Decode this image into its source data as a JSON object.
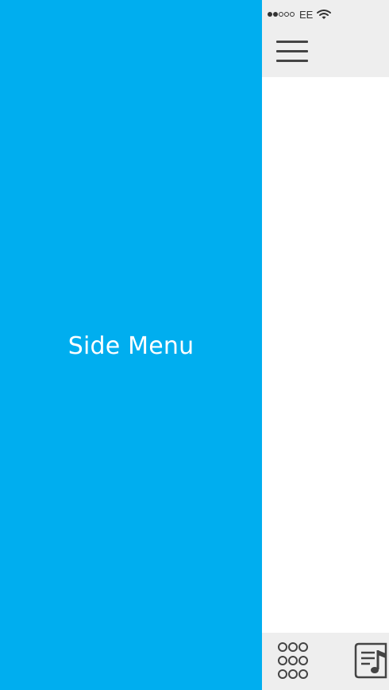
{
  "side_menu": {
    "label": "Side Menu",
    "background_color": "#00AEEF"
  },
  "status_bar": {
    "signal_filled": 2,
    "signal_total": 5,
    "carrier": "EE",
    "icons": [
      "signal-dots-icon",
      "wifi-icon"
    ]
  },
  "top_bar": {
    "menu_icon": "hamburger-menu-icon",
    "background_color": "#EEEEEE"
  },
  "bottom_bar": {
    "icons": [
      "grid-icon",
      "playlist-icon"
    ],
    "background_color": "#EEEEEE"
  }
}
